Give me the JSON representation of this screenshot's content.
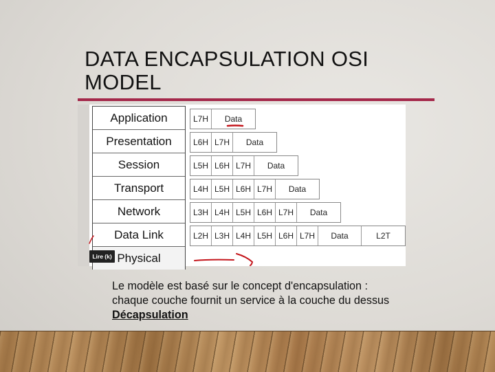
{
  "slide": {
    "title_lines": [
      "DATA ENCAPSULATION OSI",
      "MODEL"
    ],
    "accent_color": "#a4284a",
    "diagram": {
      "layers": [
        "Application",
        "Presentation",
        "Session",
        "Transport",
        "Network",
        "Data Link",
        "Physical"
      ],
      "pdu_rows": [
        [
          "L7H",
          "Data"
        ],
        [
          "L6H",
          "L7H",
          "Data"
        ],
        [
          "L5H",
          "L6H",
          "L7H",
          "Data"
        ],
        [
          "L4H",
          "L5H",
          "L6H",
          "L7H",
          "Data"
        ],
        [
          "L3H",
          "L4H",
          "L5H",
          "L6H",
          "L7H",
          "Data"
        ],
        [
          "L2H",
          "L3H",
          "L4H",
          "L5H",
          "L6H",
          "L7H",
          "Data",
          "L2T"
        ]
      ],
      "annotation_color": "#c4161c",
      "tooltip": "Lire (k)"
    },
    "body": {
      "line1": "Le modèle est basé sur le concept d'encapsulation :",
      "line2": "chaque couche fournit un service à la couche du dessus",
      "link": "Décapsulation"
    }
  }
}
